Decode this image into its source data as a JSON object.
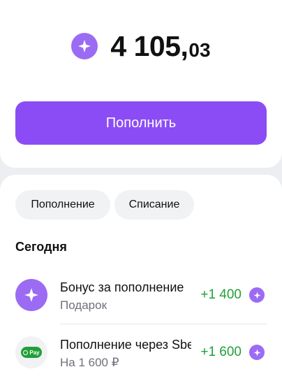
{
  "balance": {
    "integer": "4 105,",
    "fraction": "03",
    "icon": "bonus-star-icon"
  },
  "actions": {
    "topup_label": "Пополнить"
  },
  "filters": [
    {
      "label": "Пополнение"
    },
    {
      "label": "Списание"
    }
  ],
  "history": {
    "section_title": "Сегодня",
    "items": [
      {
        "title": "Бонус за пополнение",
        "subtitle": "Подарок",
        "amount": "+1 400",
        "icon": "bonus-star-icon",
        "amount_color": "#21a038"
      },
      {
        "title": "Пополнение через SberPay",
        "subtitle": "На 1 600 ₽",
        "amount": "+1 600",
        "icon": "sberpay-icon",
        "icon_label": "Pay",
        "amount_color": "#21a038"
      }
    ]
  },
  "colors": {
    "accent": "#8b4cf5",
    "bonus": "#9b6cf3",
    "income": "#21a038",
    "muted_text": "#6f717a"
  }
}
